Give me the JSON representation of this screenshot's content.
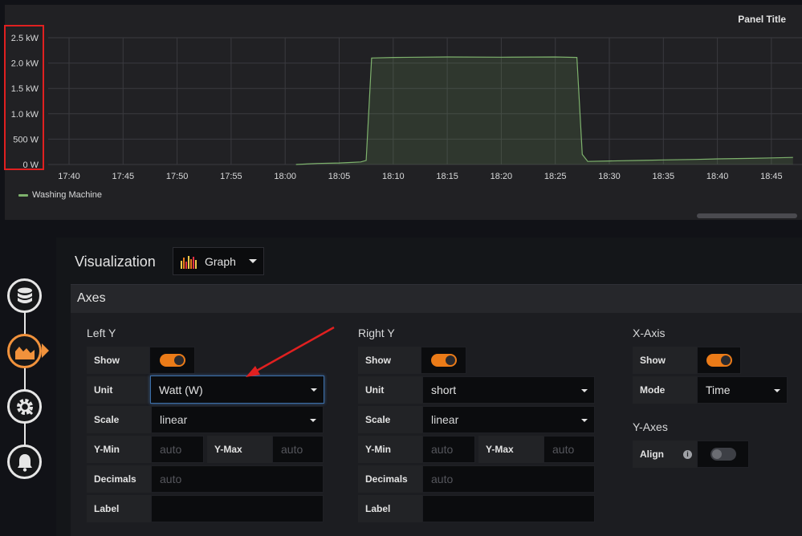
{
  "panel": {
    "title": "Panel Title",
    "legend": "Washing Machine",
    "y_ticks": [
      "2.5 kW",
      "2.0 kW",
      "1.5 kW",
      "1.0 kW",
      "500 W",
      "0 W"
    ],
    "x_ticks": [
      "17:40",
      "17:45",
      "17:50",
      "17:55",
      "18:00",
      "18:05",
      "18:10",
      "18:15",
      "18:20",
      "18:25",
      "18:30",
      "18:35",
      "18:40",
      "18:45"
    ]
  },
  "chart_data": {
    "type": "area",
    "title": "Panel Title",
    "ylim": [
      0,
      2500
    ],
    "series": [
      {
        "name": "Washing Machine",
        "color": "#7eb26d",
        "x": [
          "18:01",
          "18:03",
          "18:05",
          "18:06",
          "18:07",
          "18:07.5",
          "18:08",
          "18:10",
          "18:15",
          "18:20",
          "18:25",
          "18:27",
          "18:27.5",
          "18:28",
          "18:30",
          "18:33",
          "18:35",
          "18:38",
          "18:40",
          "18:43",
          "18:45",
          "18:47"
        ],
        "y": [
          0,
          20,
          30,
          40,
          50,
          80,
          2100,
          2110,
          2120,
          2115,
          2120,
          2110,
          200,
          60,
          70,
          80,
          90,
          100,
          110,
          120,
          130,
          140
        ]
      }
    ],
    "grid": true,
    "legend": "bottom-left"
  },
  "sidebar": {
    "items": [
      {
        "icon": "database-icon"
      },
      {
        "icon": "chart-icon"
      },
      {
        "icon": "gear-icon"
      },
      {
        "icon": "bell-icon"
      }
    ]
  },
  "visualization": {
    "label": "Visualization",
    "selected": "Graph"
  },
  "axes": {
    "title": "Axes",
    "left_y": {
      "title": "Left Y",
      "show_label": "Show",
      "unit_label": "Unit",
      "unit_value": "Watt (W)",
      "scale_label": "Scale",
      "scale_value": "linear",
      "ymin_label": "Y-Min",
      "ymin_placeholder": "auto",
      "ymax_label": "Y-Max",
      "ymax_placeholder": "auto",
      "decimals_label": "Decimals",
      "decimals_placeholder": "auto",
      "label_label": "Label"
    },
    "right_y": {
      "title": "Right Y",
      "show_label": "Show",
      "unit_label": "Unit",
      "unit_value": "short",
      "scale_label": "Scale",
      "scale_value": "linear",
      "ymin_label": "Y-Min",
      "ymin_placeholder": "auto",
      "ymax_label": "Y-Max",
      "ymax_placeholder": "auto",
      "decimals_label": "Decimals",
      "decimals_placeholder": "auto",
      "label_label": "Label"
    },
    "x_axis": {
      "title": "X-Axis",
      "show_label": "Show",
      "mode_label": "Mode",
      "mode_value": "Time"
    },
    "y_axes": {
      "title": "Y-Axes",
      "align_label": "Align"
    }
  },
  "colors": {
    "accent": "#eb7b18",
    "series": "#7eb26d",
    "highlight": "#e02020"
  }
}
